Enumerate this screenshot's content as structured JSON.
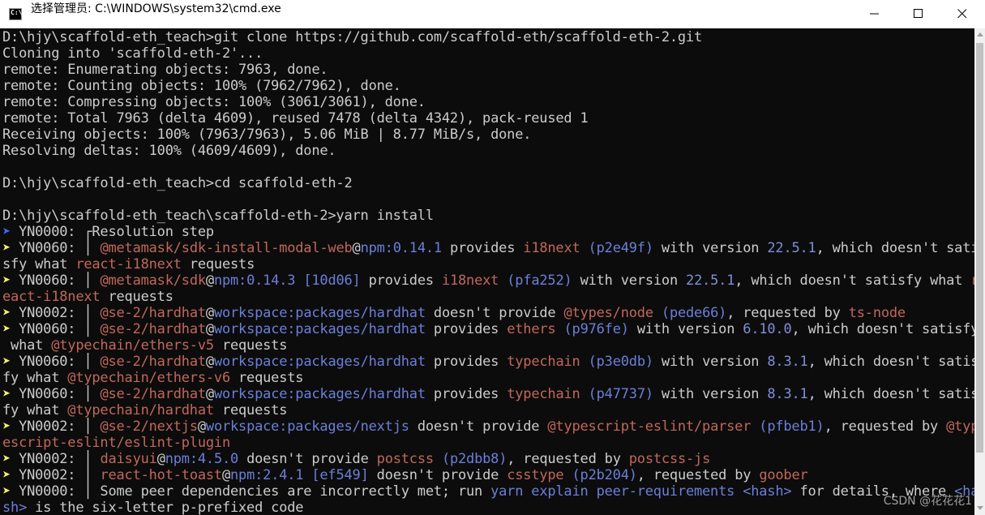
{
  "window": {
    "title": "选择管理员: C:\\WINDOWS\\system32\\cmd.exe",
    "icon_label": "C:\\",
    "buttons": [
      "minimize-icon",
      "maximize-icon",
      "close-icon"
    ]
  },
  "colors": {
    "default": "#cccccc",
    "package": "#c2675b",
    "key": "#6c7fd9",
    "version": "#7f8fdb",
    "prompt_arrow": "#4a62ff",
    "arrow": "#f6f16a"
  },
  "terminal": {
    "lines": [
      [
        [
          "d",
          "D:\\hjy\\scaffold-eth_teach>git clone https://github.com/scaffold-eth/scaffold-eth-2.git"
        ]
      ],
      [
        [
          "d",
          "Cloning into 'scaffold-eth-2'..."
        ]
      ],
      [
        [
          "d",
          "remote: Enumerating objects: 7963, done."
        ]
      ],
      [
        [
          "d",
          "remote: Counting objects: 100% (7962/7962), done."
        ]
      ],
      [
        [
          "d",
          "remote: Compressing objects: 100% (3061/3061), done."
        ]
      ],
      [
        [
          "d",
          "remote: Total 7963 (delta 4609), reused 7478 (delta 4342), pack-reused 1"
        ]
      ],
      [
        [
          "d",
          "Receiving objects: 100% (7963/7963), 5.06 MiB | 8.77 MiB/s, done."
        ]
      ],
      [
        [
          "d",
          "Resolving deltas: 100% (4609/4609), done."
        ]
      ],
      [
        [
          "d",
          ""
        ]
      ],
      [
        [
          "d",
          "D:\\hjy\\scaffold-eth_teach>cd scaffold-eth-2"
        ]
      ],
      [
        [
          "d",
          ""
        ]
      ],
      [
        [
          "d",
          "D:\\hjy\\scaffold-eth_teach\\scaffold-eth-2>yarn install"
        ]
      ],
      [
        [
          "b",
          "➤ "
        ],
        [
          "d",
          "YN0000: ┌Resolution step"
        ]
      ],
      [
        [
          "y",
          "➤ "
        ],
        [
          "d",
          "YN0060: │ "
        ],
        [
          "p",
          "@metamask/sdk-install-modal-web"
        ],
        [
          "d",
          "@"
        ],
        [
          "k",
          "npm:0.14.1"
        ],
        [
          "d",
          " provides "
        ],
        [
          "p",
          "i18next"
        ],
        [
          "d",
          " "
        ],
        [
          "k",
          "(p2e49f)"
        ],
        [
          "d",
          " with version "
        ],
        [
          "v",
          "22.5.1"
        ],
        [
          "d",
          ", which doesn't sati"
        ]
      ],
      [
        [
          "d",
          "sfy what "
        ],
        [
          "p",
          "react-i18next"
        ],
        [
          "d",
          " requests"
        ]
      ],
      [
        [
          "y",
          "➤ "
        ],
        [
          "d",
          "YN0060: │ "
        ],
        [
          "p",
          "@metamask/sdk"
        ],
        [
          "d",
          "@"
        ],
        [
          "k",
          "npm:0.14.3 [10d06]"
        ],
        [
          "d",
          " provides "
        ],
        [
          "p",
          "i18next"
        ],
        [
          "d",
          " "
        ],
        [
          "k",
          "(pfa252)"
        ],
        [
          "d",
          " with version "
        ],
        [
          "v",
          "22.5.1"
        ],
        [
          "d",
          ", which doesn't satisfy what "
        ],
        [
          "p",
          "r"
        ]
      ],
      [
        [
          "p",
          "eact-i18next"
        ],
        [
          "d",
          " requests"
        ]
      ],
      [
        [
          "y",
          "➤ "
        ],
        [
          "d",
          "YN0002: │ "
        ],
        [
          "p",
          "@se-2/hardhat"
        ],
        [
          "d",
          "@"
        ],
        [
          "k",
          "workspace:packages/hardhat"
        ],
        [
          "d",
          " doesn't provide "
        ],
        [
          "p",
          "@types/node"
        ],
        [
          "d",
          " "
        ],
        [
          "k",
          "(pede66)"
        ],
        [
          "d",
          ", requested by "
        ],
        [
          "p",
          "ts-node"
        ]
      ],
      [
        [
          "y",
          "➤ "
        ],
        [
          "d",
          "YN0060: │ "
        ],
        [
          "p",
          "@se-2/hardhat"
        ],
        [
          "d",
          "@"
        ],
        [
          "k",
          "workspace:packages/hardhat"
        ],
        [
          "d",
          " provides "
        ],
        [
          "p",
          "ethers"
        ],
        [
          "d",
          " "
        ],
        [
          "k",
          "(p976fe)"
        ],
        [
          "d",
          " with version "
        ],
        [
          "v",
          "6.10.0"
        ],
        [
          "d",
          ", which doesn't satisfy"
        ]
      ],
      [
        [
          "d",
          " what "
        ],
        [
          "p",
          "@typechain/ethers-v5"
        ],
        [
          "d",
          " requests"
        ]
      ],
      [
        [
          "y",
          "➤ "
        ],
        [
          "d",
          "YN0060: │ "
        ],
        [
          "p",
          "@se-2/hardhat"
        ],
        [
          "d",
          "@"
        ],
        [
          "k",
          "workspace:packages/hardhat"
        ],
        [
          "d",
          " provides "
        ],
        [
          "p",
          "typechain"
        ],
        [
          "d",
          " "
        ],
        [
          "k",
          "(p3e0db)"
        ],
        [
          "d",
          " with version "
        ],
        [
          "v",
          "8.3.1"
        ],
        [
          "d",
          ", which doesn't satis"
        ]
      ],
      [
        [
          "d",
          "fy what "
        ],
        [
          "p",
          "@typechain/ethers-v6"
        ],
        [
          "d",
          " requests"
        ]
      ],
      [
        [
          "y",
          "➤ "
        ],
        [
          "d",
          "YN0060: │ "
        ],
        [
          "p",
          "@se-2/hardhat"
        ],
        [
          "d",
          "@"
        ],
        [
          "k",
          "workspace:packages/hardhat"
        ],
        [
          "d",
          " provides "
        ],
        [
          "p",
          "typechain"
        ],
        [
          "d",
          " "
        ],
        [
          "k",
          "(p47737)"
        ],
        [
          "d",
          " with version "
        ],
        [
          "v",
          "8.3.1"
        ],
        [
          "d",
          ", which doesn't satis"
        ]
      ],
      [
        [
          "d",
          "fy what "
        ],
        [
          "p",
          "@typechain/hardhat"
        ],
        [
          "d",
          " requests"
        ]
      ],
      [
        [
          "y",
          "➤ "
        ],
        [
          "d",
          "YN0002: │ "
        ],
        [
          "p",
          "@se-2/nextjs"
        ],
        [
          "d",
          "@"
        ],
        [
          "k",
          "workspace:packages/nextjs"
        ],
        [
          "d",
          " doesn't provide "
        ],
        [
          "p",
          "@typescript-eslint/parser"
        ],
        [
          "d",
          " "
        ],
        [
          "k",
          "(pfbeb1)"
        ],
        [
          "d",
          ", requested by "
        ],
        [
          "p",
          "@typ"
        ]
      ],
      [
        [
          "p",
          "escript-eslint/eslint-plugin"
        ]
      ],
      [
        [
          "y",
          "➤ "
        ],
        [
          "d",
          "YN0002: │ "
        ],
        [
          "p",
          "daisyui"
        ],
        [
          "d",
          "@"
        ],
        [
          "k",
          "npm:4.5.0"
        ],
        [
          "d",
          " doesn't provide "
        ],
        [
          "p",
          "postcss"
        ],
        [
          "d",
          " "
        ],
        [
          "k",
          "(p2dbb8)"
        ],
        [
          "d",
          ", requested by "
        ],
        [
          "p",
          "postcss-js"
        ]
      ],
      [
        [
          "y",
          "➤ "
        ],
        [
          "d",
          "YN0002: │ "
        ],
        [
          "p",
          "react-hot-toast"
        ],
        [
          "d",
          "@"
        ],
        [
          "k",
          "npm:2.4.1 [ef549]"
        ],
        [
          "d",
          " doesn't provide "
        ],
        [
          "p",
          "csstype"
        ],
        [
          "d",
          " "
        ],
        [
          "k",
          "(p2b204)"
        ],
        [
          "d",
          ", requested by "
        ],
        [
          "p",
          "goober"
        ]
      ],
      [
        [
          "y",
          "➤ "
        ],
        [
          "d",
          "YN0000: │ Some peer dependencies are incorrectly met; run "
        ],
        [
          "k",
          "yarn explain peer-requirements <hash>"
        ],
        [
          "d",
          " for details, where "
        ],
        [
          "k",
          "<ha"
        ]
      ],
      [
        [
          "k",
          "sh>"
        ],
        [
          "d",
          " is the six-letter p-prefixed code"
        ]
      ]
    ]
  },
  "watermark": "CSDN @花花花1"
}
